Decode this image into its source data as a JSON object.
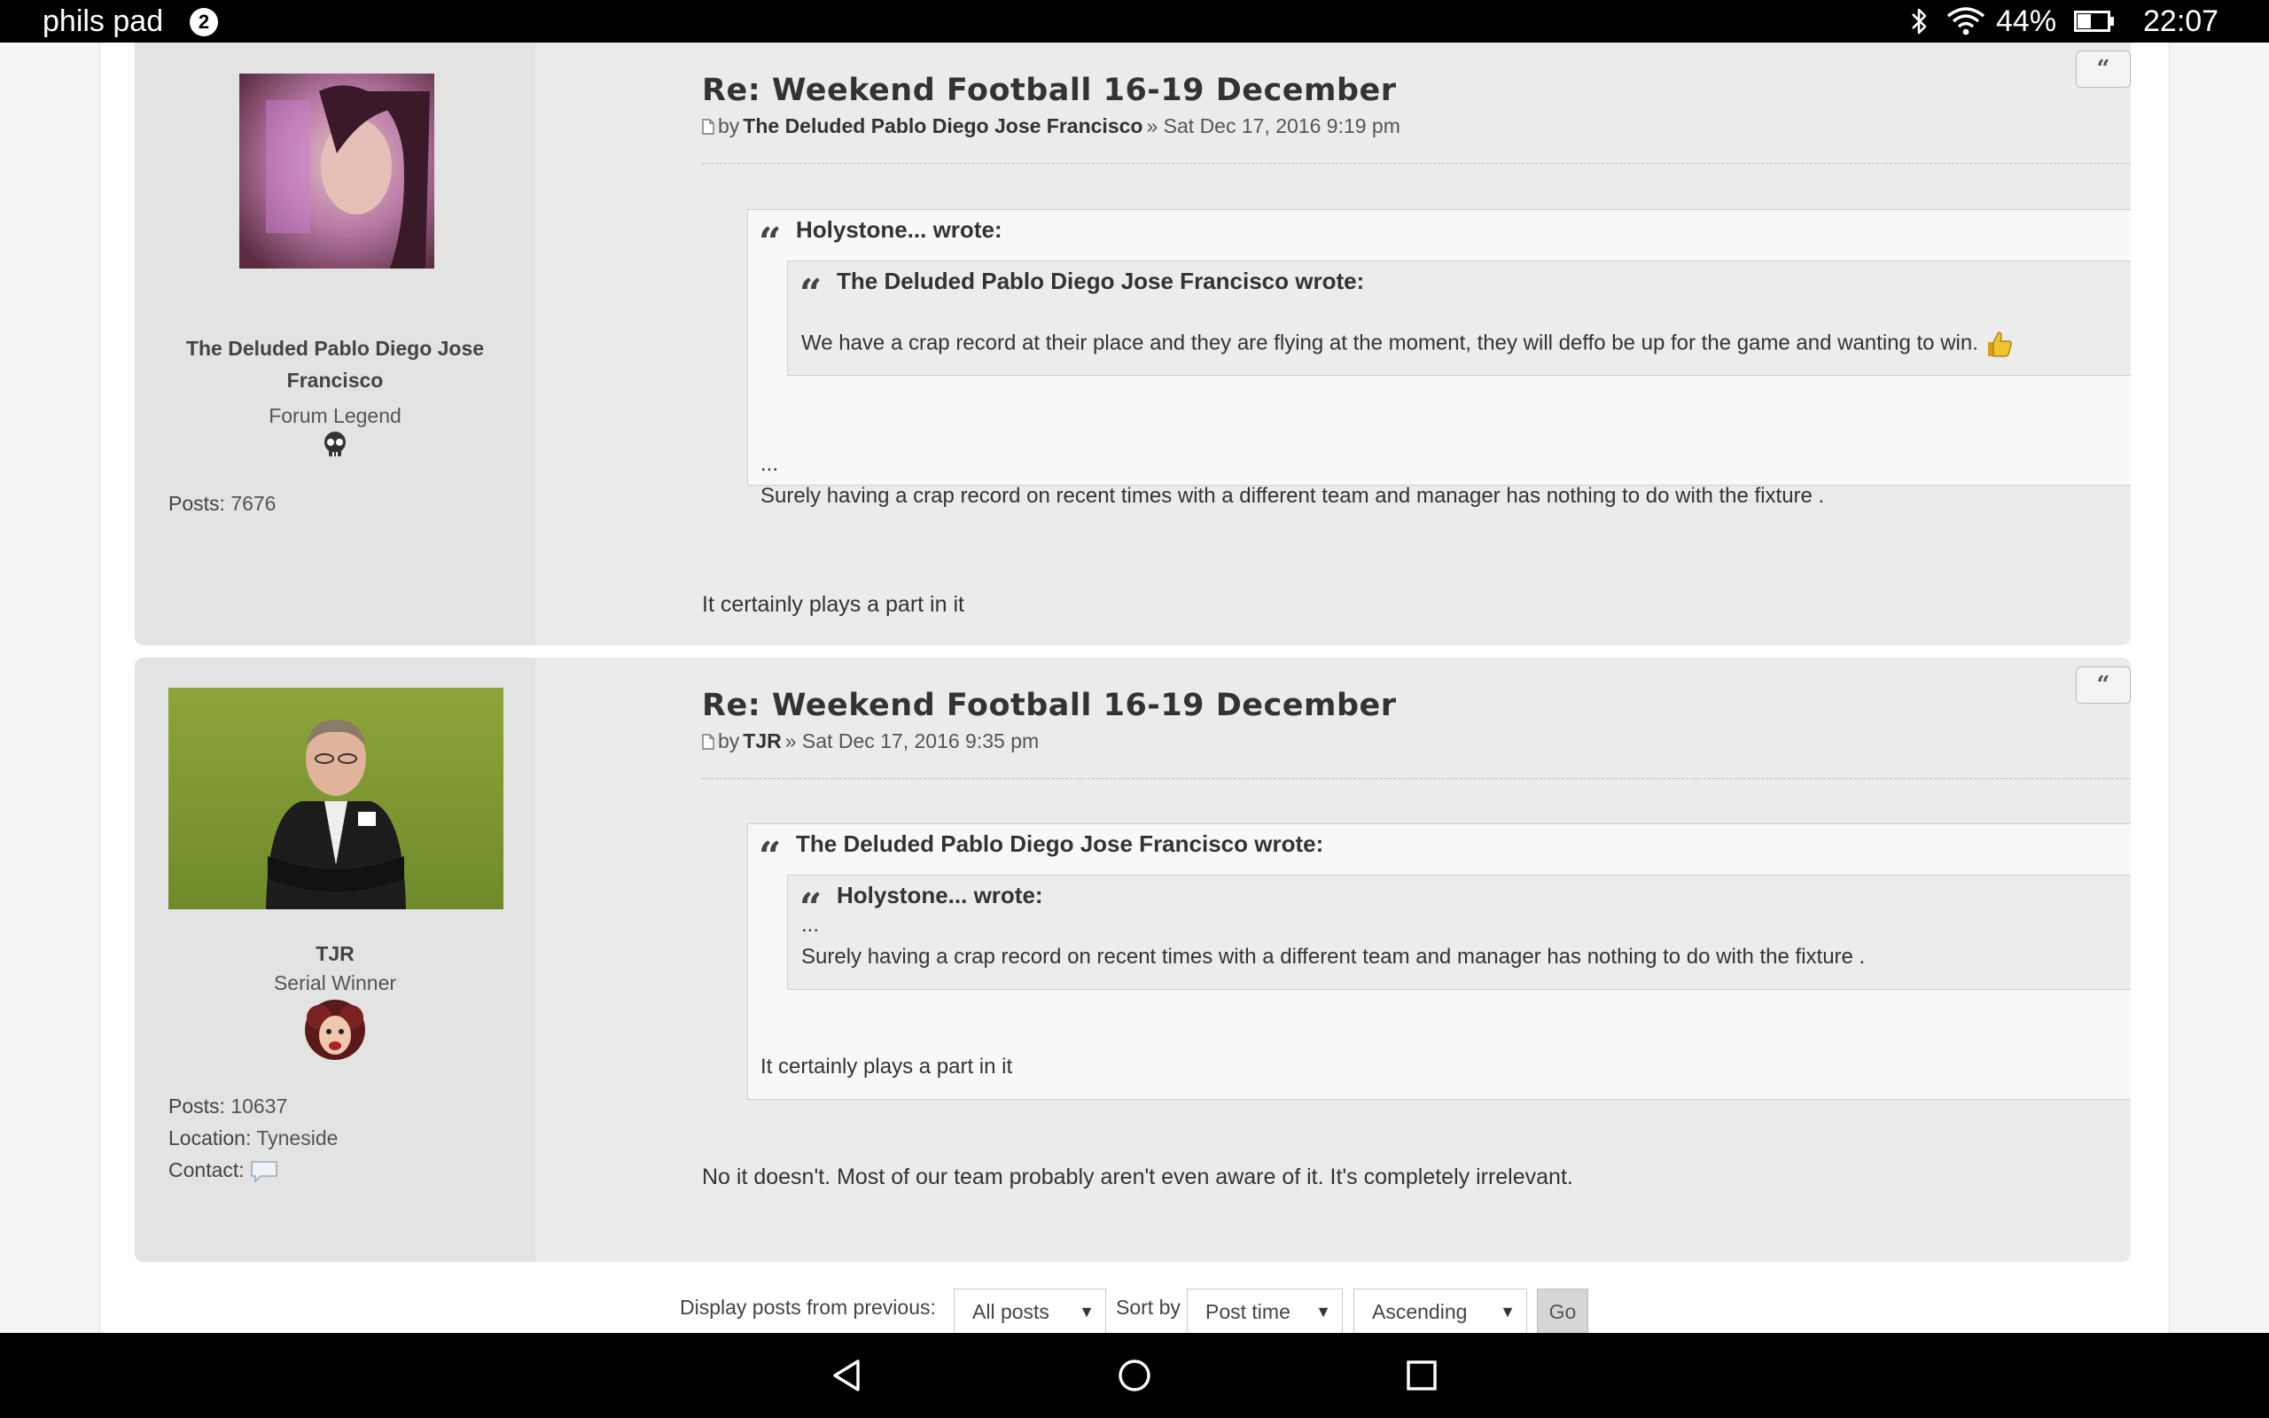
{
  "status_bar": {
    "device_name": "phils pad",
    "notification_count": "2",
    "battery": "44%",
    "time": "22:07",
    "icons": [
      "bluetooth-icon",
      "wifi-icon",
      "battery-icon"
    ]
  },
  "posts": [
    {
      "author_name": "The Deluded Pablo Diego Jose Francisco",
      "author_name_line1": "The Deluded Pablo Diego Jose",
      "author_name_line2": "Francisco",
      "rank": "Forum Legend",
      "posts_label": "Posts:",
      "posts_count": "7676",
      "title": "Re: Weekend Football 16-19 December",
      "by": "by",
      "author": "The Deluded Pablo Diego Jose Francisco",
      "date": "» Sat Dec 17, 2016 9:19 pm",
      "quote": {
        "author": "Holystone... wrote:",
        "nested": {
          "author": "The Deluded Pablo Diego Jose Francisco wrote:",
          "text": "We have a crap record at their place and they are flying at the moment, they will deffo be up for the game and wanting to win."
        },
        "ellipsis": "...",
        "text": "Surely having a crap record on recent times with a different team and manager has nothing to do with the fixture ."
      },
      "body": "It certainly plays a part in it"
    },
    {
      "author_name": "TJR",
      "rank": "Serial Winner",
      "posts_label": "Posts:",
      "posts_count": "10637",
      "location_label": "Location:",
      "location": "Tyneside",
      "contact_label": "Contact:",
      "title": "Re: Weekend Football 16-19 December",
      "by": "by",
      "author": "TJR",
      "date": "» Sat Dec 17, 2016 9:35 pm",
      "quote": {
        "author": "The Deluded Pablo Diego Jose Francisco wrote:",
        "nested": {
          "author": "Holystone... wrote:",
          "ellipsis": "...",
          "text": "Surely having a crap record on recent times with a different team and manager has nothing to do with the fixture ."
        },
        "text": "It certainly plays a part in it"
      },
      "body": "No it doesn't. Most of our team probably aren't even aware of it. It's completely irrelevant."
    }
  ],
  "quote_button_label": "“",
  "display_options": {
    "display_label": "Display posts from previous:",
    "display_value": "All posts",
    "sort_label": "Sort by",
    "sort_value": "Post time",
    "order_value": "Ascending",
    "go_label": "Go"
  },
  "nav_bar": [
    "back-icon",
    "home-icon",
    "recents-icon"
  ]
}
